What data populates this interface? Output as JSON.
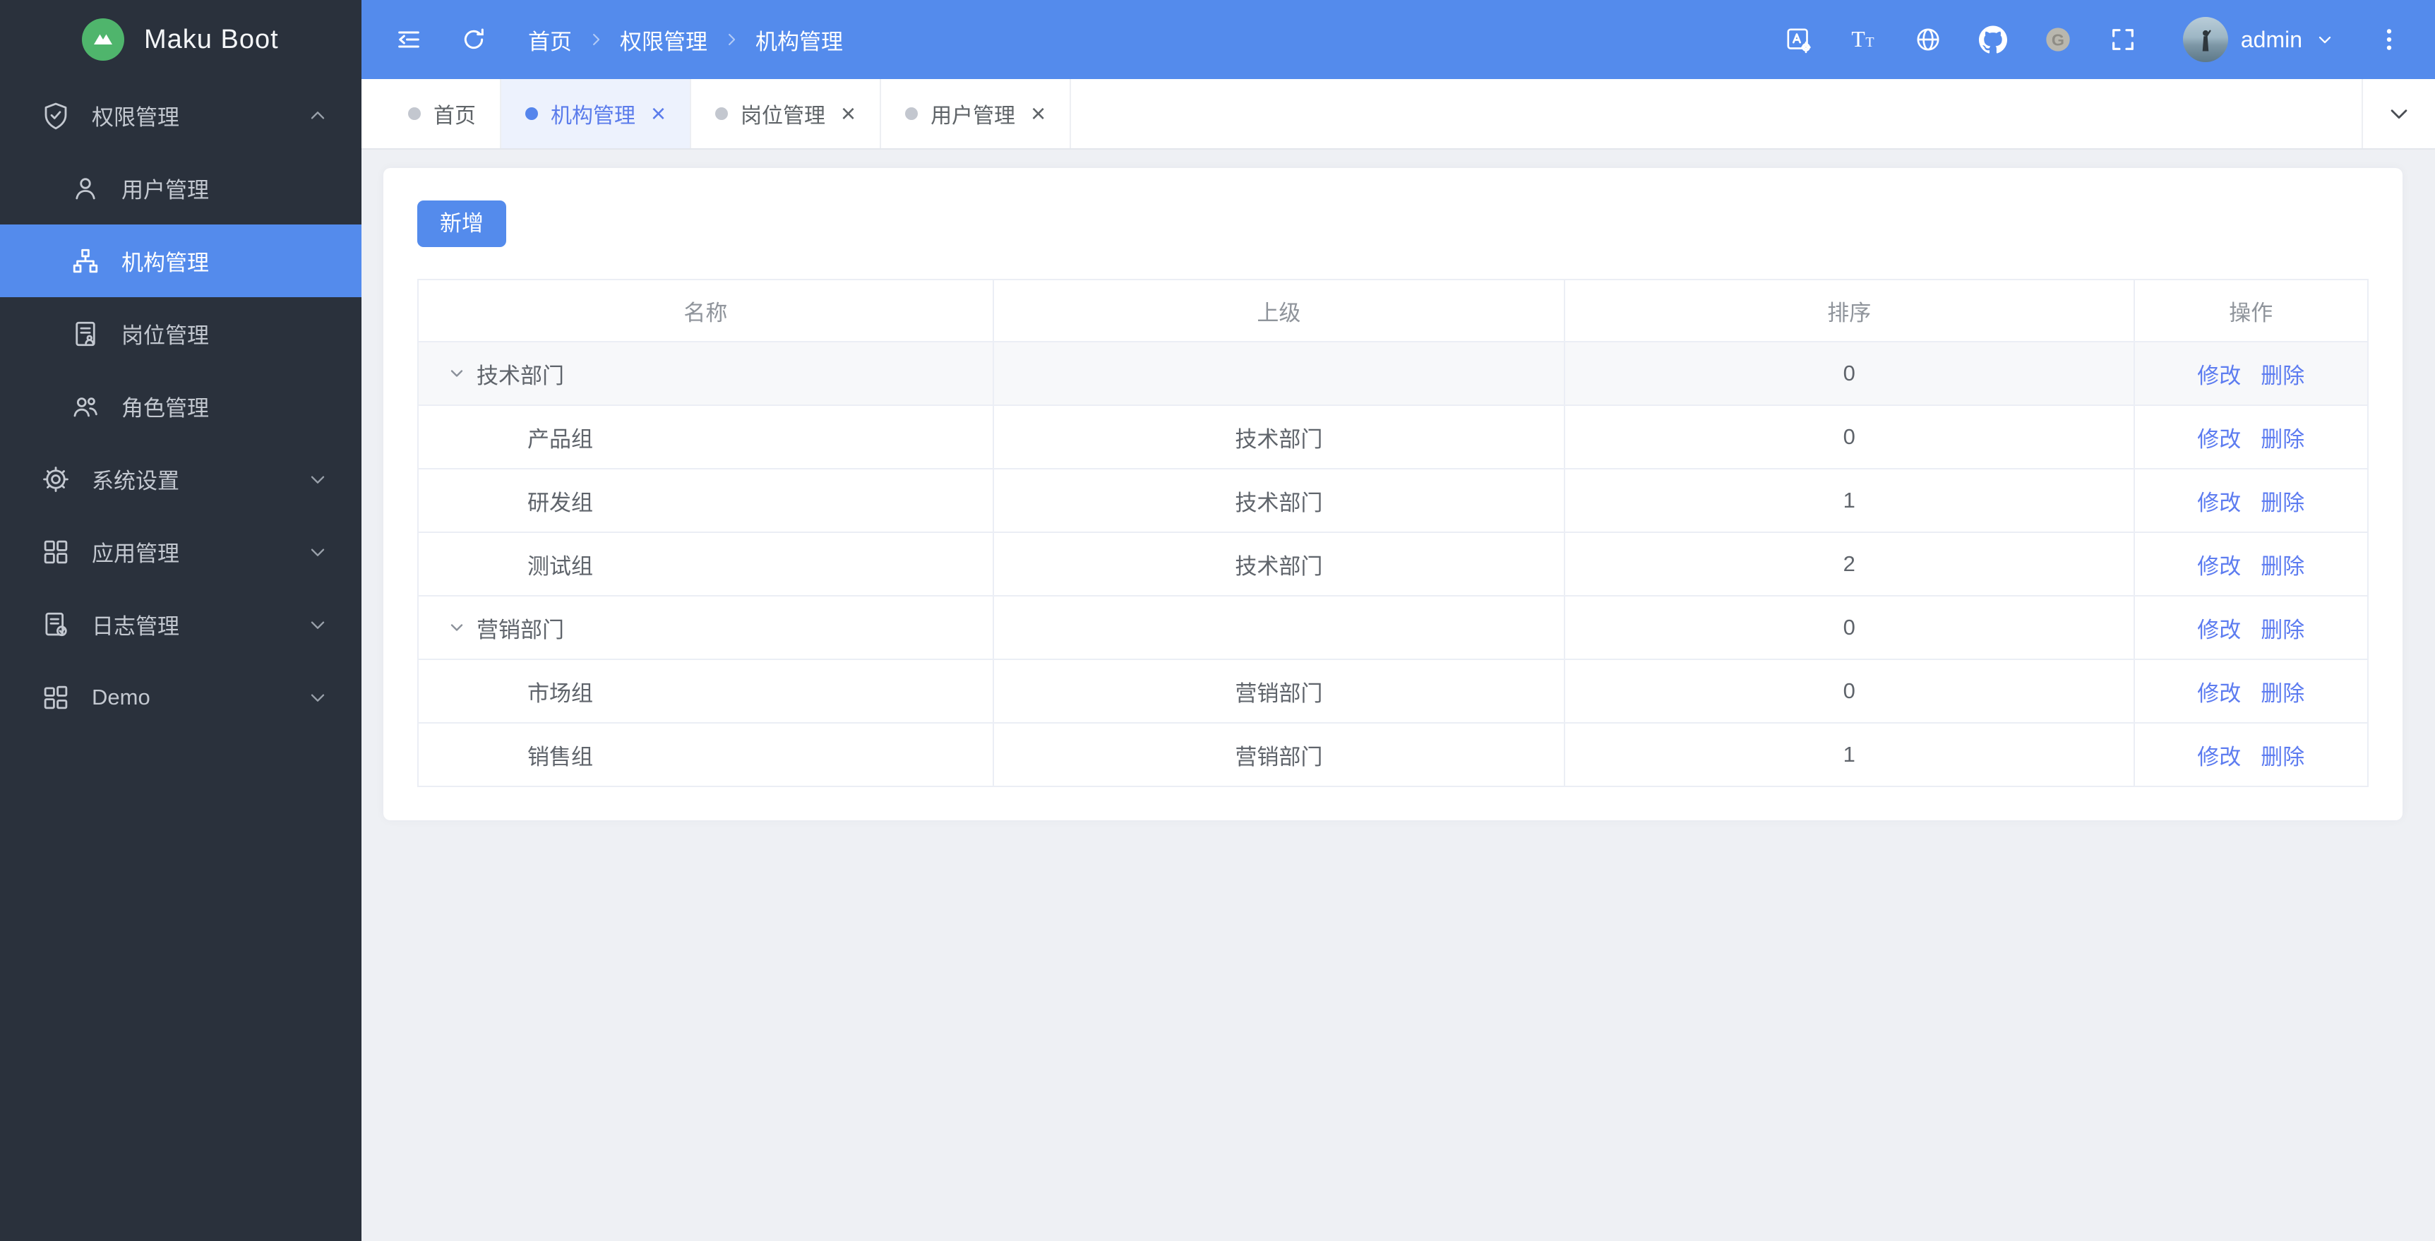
{
  "app": {
    "title": "Maku Boot"
  },
  "colors": {
    "primary": "#548bec",
    "sidebar_bg": "#2a313c",
    "active_tab_bg": "#edf2fd",
    "link": "#5d7cf0",
    "content_bg": "#eef0f4",
    "logo_green": "#4fb56c"
  },
  "sidebar": {
    "logo_text": "Maku Boot",
    "groups": [
      {
        "label": "权限管理",
        "icon": "shield-check-icon",
        "expanded": true,
        "active": false,
        "children": [
          {
            "label": "用户管理",
            "icon": "user-icon",
            "active": false
          },
          {
            "label": "机构管理",
            "icon": "org-tree-icon",
            "active": true
          },
          {
            "label": "岗位管理",
            "icon": "post-doc-icon",
            "active": false
          },
          {
            "label": "角色管理",
            "icon": "roles-icon",
            "active": false
          }
        ]
      },
      {
        "label": "系统设置",
        "icon": "gear-icon",
        "expanded": false,
        "active": false,
        "children": []
      },
      {
        "label": "应用管理",
        "icon": "apps-grid-icon",
        "expanded": false,
        "active": false,
        "children": []
      },
      {
        "label": "日志管理",
        "icon": "log-doc-icon",
        "expanded": false,
        "active": false,
        "children": []
      },
      {
        "label": "Demo",
        "icon": "demo-grid-icon",
        "expanded": false,
        "active": false,
        "children": []
      }
    ]
  },
  "header": {
    "breadcrumb": [
      "首页",
      "权限管理",
      "机构管理"
    ],
    "right_icons": [
      "translate-icon",
      "font-size-icon",
      "globe-icon",
      "github-icon",
      "gitee-icon",
      "fullscreen-icon"
    ],
    "user": {
      "name": "admin"
    }
  },
  "tabs": [
    {
      "label": "首页",
      "closable": false,
      "active": false
    },
    {
      "label": "机构管理",
      "closable": true,
      "active": true
    },
    {
      "label": "岗位管理",
      "closable": true,
      "active": false
    },
    {
      "label": "用户管理",
      "closable": true,
      "active": false
    }
  ],
  "toolbar": {
    "add_label": "新增"
  },
  "table": {
    "columns": [
      "名称",
      "上级",
      "排序",
      "操作"
    ],
    "actions": {
      "edit": "修改",
      "delete": "删除"
    },
    "rows": [
      {
        "name": "技术部门",
        "parent": "",
        "sort": "0",
        "level": 0,
        "expandable": true,
        "highlighted": true
      },
      {
        "name": "产品组",
        "parent": "技术部门",
        "sort": "0",
        "level": 1,
        "expandable": false,
        "highlighted": false
      },
      {
        "name": "研发组",
        "parent": "技术部门",
        "sort": "1",
        "level": 1,
        "expandable": false,
        "highlighted": false
      },
      {
        "name": "测试组",
        "parent": "技术部门",
        "sort": "2",
        "level": 1,
        "expandable": false,
        "highlighted": false
      },
      {
        "name": "营销部门",
        "parent": "",
        "sort": "0",
        "level": 0,
        "expandable": true,
        "highlighted": false
      },
      {
        "name": "市场组",
        "parent": "营销部门",
        "sort": "0",
        "level": 1,
        "expandable": false,
        "highlighted": false
      },
      {
        "name": "销售组",
        "parent": "营销部门",
        "sort": "1",
        "level": 1,
        "expandable": false,
        "highlighted": false
      }
    ]
  }
}
